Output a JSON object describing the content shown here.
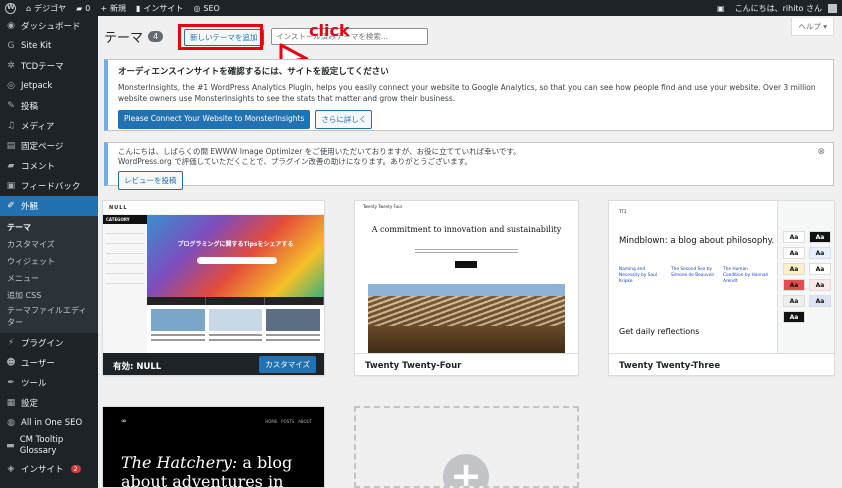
{
  "adminbar": {
    "site_name": "デジゴヤ",
    "comments_count": "0",
    "new_label": "新規",
    "insights_label": "インサイト",
    "seo_label": "SEO",
    "greeting": "こんにちは、rihito さん"
  },
  "sidebar": {
    "items": [
      {
        "icon": "dashboard-icon",
        "glyph": "◉",
        "label": "ダッシュボード"
      },
      {
        "icon": "sitekit-icon",
        "glyph": "G",
        "label": "Site Kit"
      },
      {
        "icon": "gear-icon",
        "glyph": "✲",
        "label": "TCDテーマ"
      },
      {
        "icon": "jetpack-icon",
        "glyph": "◎",
        "label": "Jetpack"
      },
      {
        "icon": "pin-icon",
        "glyph": "✎",
        "label": "投稿"
      },
      {
        "icon": "media-icon",
        "glyph": "♫",
        "label": "メディア"
      },
      {
        "icon": "page-icon",
        "glyph": "▤",
        "label": "固定ページ"
      },
      {
        "icon": "comment-icon",
        "glyph": "▰",
        "label": "コメント"
      },
      {
        "icon": "feedback-icon",
        "glyph": "▣",
        "label": "フィードバック"
      },
      {
        "icon": "appearance-icon",
        "glyph": "✐",
        "label": "外観"
      }
    ],
    "submenu": [
      "テーマ",
      "カスタマイズ",
      "ウィジェット",
      "メニュー",
      "追加 CSS",
      "テーマファイルエディター"
    ],
    "items_after": [
      {
        "icon": "plugin-icon",
        "glyph": "⚡",
        "label": "プラグイン"
      },
      {
        "icon": "user-icon",
        "glyph": "☻",
        "label": "ユーザー"
      },
      {
        "icon": "tool-icon",
        "glyph": "✒",
        "label": "ツール"
      },
      {
        "icon": "settings-icon",
        "glyph": "▦",
        "label": "設定"
      },
      {
        "icon": "aioseo-icon",
        "glyph": "◍",
        "label": "All in One SEO"
      },
      {
        "icon": "tooltip-icon",
        "glyph": "▬",
        "label": "CM Tooltip Glossary"
      },
      {
        "icon": "insights-icon",
        "glyph": "◈",
        "label": "インサイト",
        "badge": "2"
      }
    ]
  },
  "header": {
    "title": "テーマ",
    "count": "4",
    "add_button": "新しいテーマを追加",
    "search_placeholder": "インストール済みテーマを検索...",
    "help": "ヘルプ ▾",
    "annotation": "click"
  },
  "notice_insights": {
    "title": "オーディエンスインサイトを確認するには、サイトを設定してください",
    "text": "MonsterInsights, the #1 WordPress Analytics Plugin, helps you easily connect your website to Google Analytics, so that you can see how people find and use your website. Over 3 million website owners use MonsterInsights to see the stats that matter and grow their business.",
    "primary_button": "Please Connect Your Website to MonsterInsights",
    "secondary_button": "さらに詳しく"
  },
  "notice_review": {
    "text_line1": "こんにちは、しばらくの間 EWWW Image Optimizer をご使用いただいておりますが、お役に立てていれば幸いです。",
    "text_line2": "WordPress.org で評価していただくことで、プラグイン改善の助けになります。ありがとうございます。",
    "button": "レビューを投稿",
    "dismiss": "⊗"
  },
  "themes": [
    {
      "name": "NULL",
      "active_prefix": "有効:",
      "customize": "カスタマイズ",
      "logo": "NULL",
      "category": "CATEGORY",
      "hero_text": "プログラミングに関するTipsをシェアする"
    },
    {
      "name": "Twenty Twenty-Four",
      "brand": "Twenty Twenty Four",
      "headline": "A commitment to innovation and sustainability"
    },
    {
      "name": "Twenty Twenty-Three",
      "headline": "Mindblown: a blog about philosophy.",
      "col1": "Naming and Necessity by Saul Kripke",
      "col2": "The Second Sex by Simone de Beauvoir",
      "col3": "The Human Condition by Hannah Arendt",
      "daily": "Get daily reflections",
      "swatch": "Aa"
    },
    {
      "name": "The Hatchery",
      "logo": "∞",
      "title_italic": "The Hatchery:",
      "title_rest": " a blog",
      "title_line2": "about adventures in"
    }
  ],
  "add_theme_tile": "+"
}
